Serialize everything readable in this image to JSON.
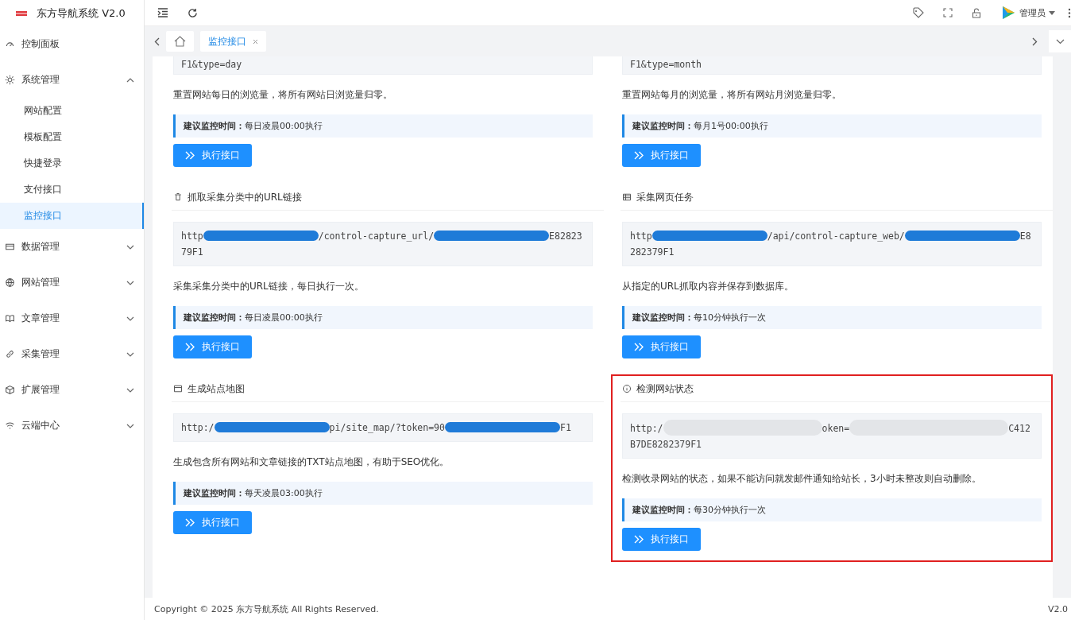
{
  "app": {
    "title": "东方导航系统 V2.0"
  },
  "sidebar": {
    "items": [
      {
        "label": "控制面板"
      },
      {
        "label": "系统管理",
        "expanded": true,
        "children": [
          {
            "label": "网站配置",
            "selected": false
          },
          {
            "label": "模板配置",
            "selected": false
          },
          {
            "label": "快捷登录",
            "selected": false
          },
          {
            "label": "支付接口",
            "selected": false
          },
          {
            "label": "监控接口",
            "selected": true
          }
        ]
      },
      {
        "label": "数据管理",
        "expanded": false
      },
      {
        "label": "网站管理",
        "expanded": false
      },
      {
        "label": "文章管理",
        "expanded": false
      },
      {
        "label": "采集管理",
        "expanded": false
      },
      {
        "label": "扩展管理",
        "expanded": false
      },
      {
        "label": "云端中心",
        "expanded": false
      }
    ]
  },
  "header": {
    "user": "管理员"
  },
  "tabs": [
    {
      "kind": "home",
      "selected": false
    },
    {
      "kind": "page",
      "label": "监控接口",
      "selected": true
    }
  ],
  "cards": [
    {
      "url": [
        {
          "kind": "text",
          "text": "F1&type=day"
        }
      ],
      "description": "重置网站每日的浏览量，将所有网站日浏览量归零。",
      "tip": "**建议监控时间：**每日凌晨00:00执行",
      "button": "执行接口"
    },
    {
      "url": [
        {
          "kind": "text",
          "text": "F1&type=month"
        }
      ],
      "description": "重置网站每月的浏览量，将所有网站月浏览量归零。",
      "tip": "**建议监控时间：**每月1号00:00执行",
      "button": "执行接口"
    },
    {
      "title": "抓取采集分类中的URL链接",
      "url": [
        {
          "kind": "text",
          "text": "http"
        },
        {
          "kind": "scribble"
        },
        {
          "kind": "text",
          "text": "/control-capture_url/"
        },
        {
          "kind": "scribble"
        },
        {
          "kind": "text",
          "text": "E8282379F1"
        }
      ],
      "description": "采集采集分类中的URL链接，每日执行一次。",
      "tip": "**建议监控时间：**每日凌晨00:00执行",
      "button": "执行接口"
    },
    {
      "title": "采集网页任务",
      "url": [
        {
          "kind": "text",
          "text": "http"
        },
        {
          "kind": "scribble"
        },
        {
          "kind": "text",
          "text": "/api/control-capture_web/"
        },
        {
          "kind": "scribble"
        },
        {
          "kind": "text",
          "text": "E8282379F1"
        }
      ],
      "description": "从指定的URL抓取内容并保存到数据库。",
      "tip": "**建议监控时间：**每10分钟执行一次",
      "button": "执行接口"
    },
    {
      "title": "生成站点地图",
      "url": [
        {
          "kind": "text",
          "text": "http:/"
        },
        {
          "kind": "scribble"
        },
        {
          "kind": "text",
          "text": "pi/site_map/?token=90"
        },
        {
          "kind": "scribble"
        },
        {
          "kind": "text",
          "text": "F1"
        }
      ],
      "description": "生成包含所有网站和文章链接的TXT站点地图，有助于SEO优化。",
      "tip": "**建议监控时间：**每天凌晨03:00执行",
      "button": "执行接口"
    },
    {
      "title": "检测网站状态",
      "url": [
        {
          "kind": "text",
          "text": "http:/"
        },
        {
          "kind": "blur"
        },
        {
          "kind": "text",
          "text": "oken="
        },
        {
          "kind": "blur"
        },
        {
          "kind": "text",
          "text": "C412B7DE8282379F1"
        }
      ],
      "description": "检测收录网站的状态，如果不能访问就发邮件通知给站长，3小时未整改则自动删除。",
      "tip": "**建议监控时间：**每30分钟执行一次",
      "button": "执行接口",
      "highlighted": true
    }
  ],
  "footer": {
    "copyright": "Copyright © 2025 东方导航系统 All Rights Reserved.",
    "version": "V2.0"
  }
}
